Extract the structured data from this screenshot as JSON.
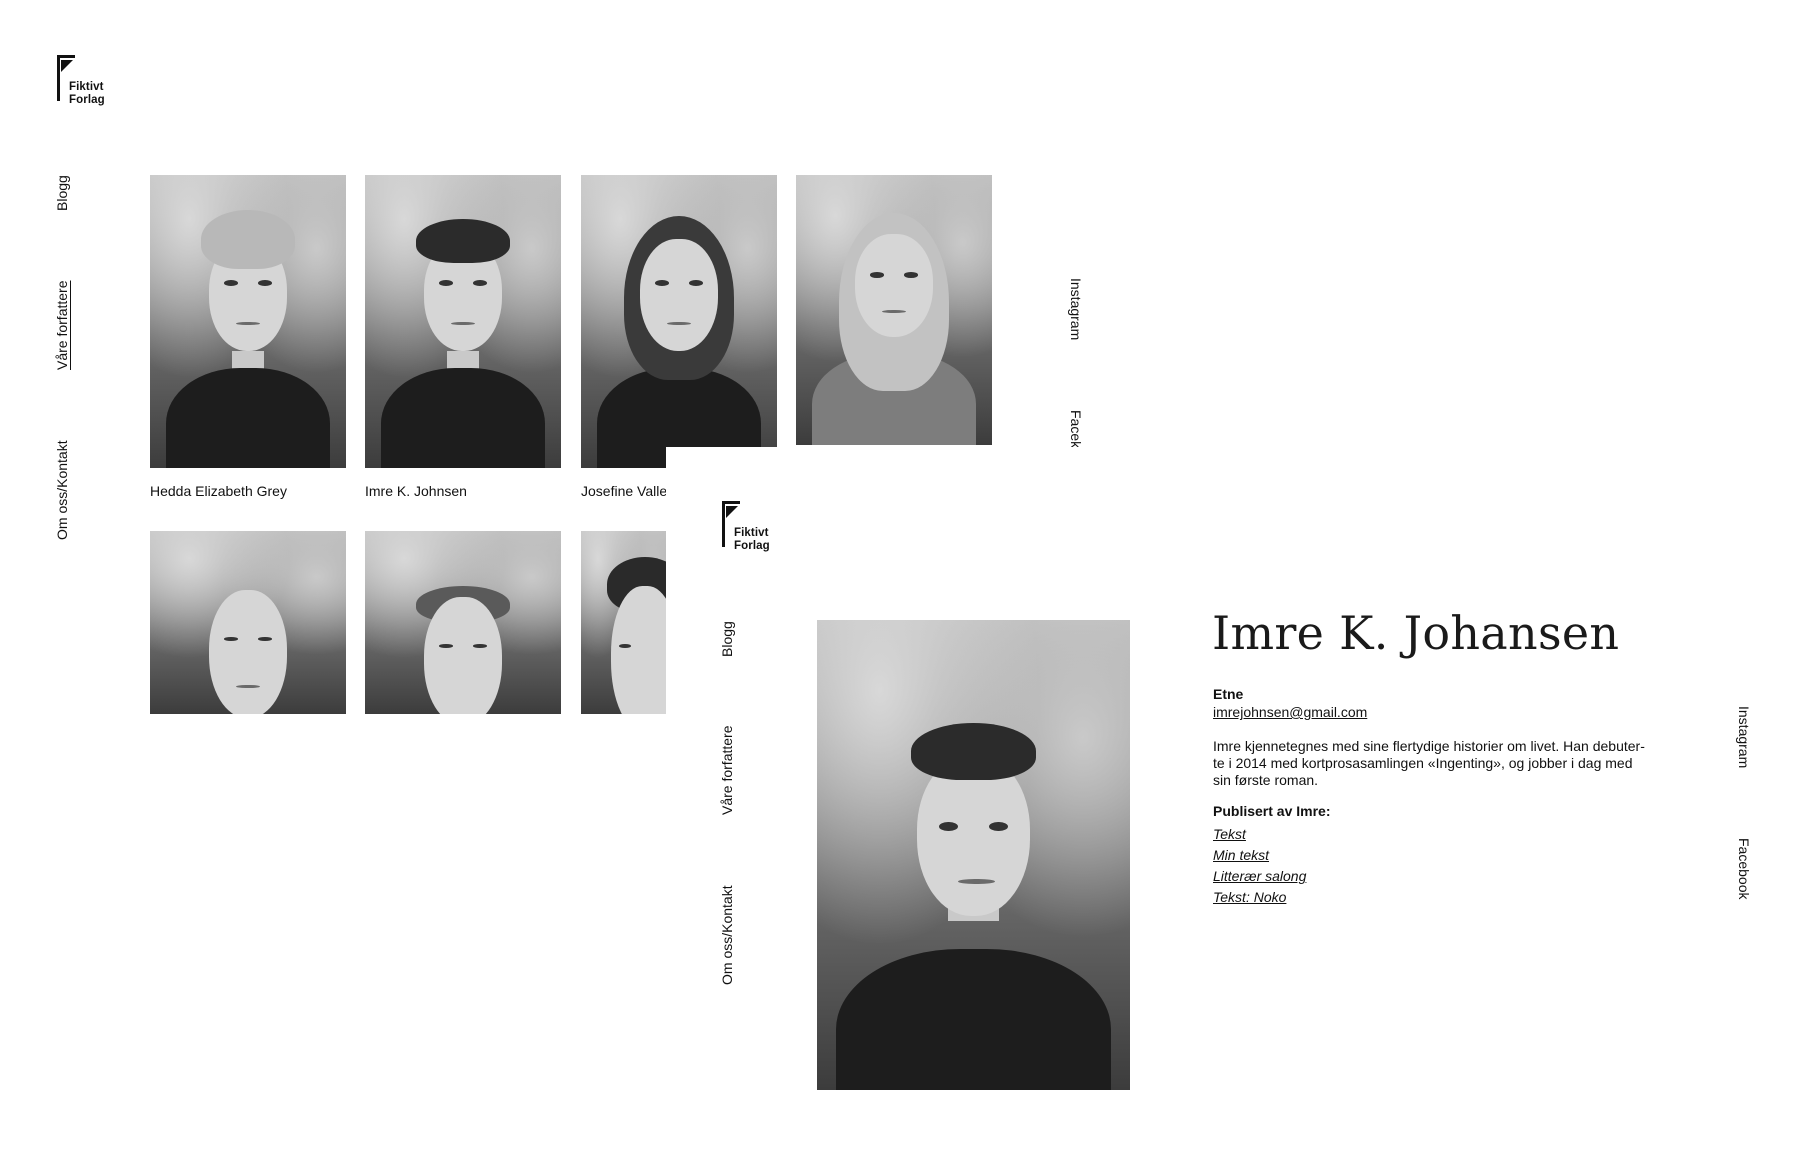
{
  "brand": {
    "line1": "Fiktivt",
    "line2": "Forlag"
  },
  "nav": {
    "blog": "Blogg",
    "authors": "Våre forfattere",
    "about": "Om oss/Kontakt"
  },
  "social": {
    "instagram": "Instagram",
    "facebook_cut": "Facek",
    "facebook": "Facebook"
  },
  "grid": {
    "captions": [
      "Hedda Elizabeth Grey",
      "Imre K. Johnsen",
      "Josefine Valle"
    ]
  },
  "author": {
    "name": "Imre K. Johansen",
    "location": "Etne",
    "email": "imrejohnsen@gmail.com",
    "bio": "Imre kjennetegnes med sine flertydige historier om livet. Han debuter-te i 2014 med kortprosasamlingen «Ingenting», og jobber i dag med sin første roman.",
    "published_title": "Publisert av Imre:",
    "published": [
      "Tekst",
      "Min tekst",
      "Litterær salong ",
      "Tekst: Noko"
    ]
  }
}
